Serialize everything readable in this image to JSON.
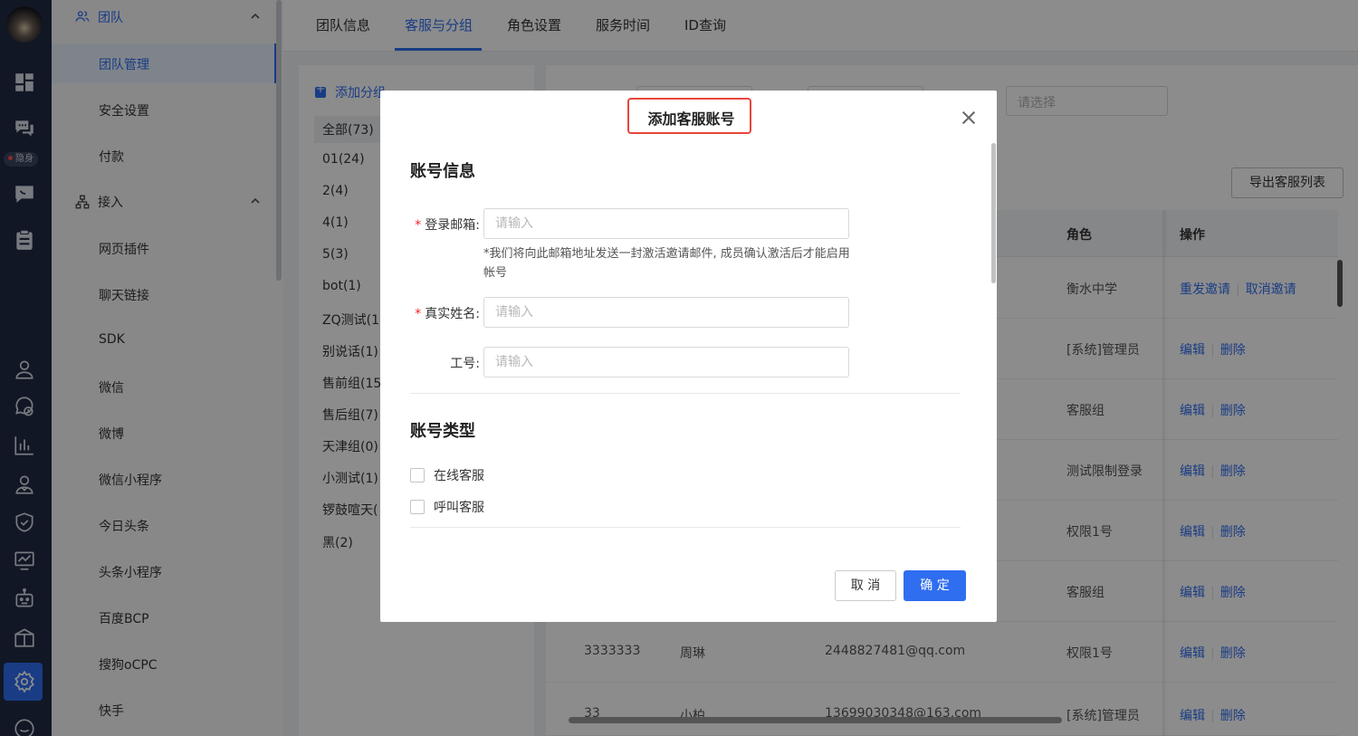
{
  "rail": {
    "badge_label": "隐身"
  },
  "sidebar": {
    "groups": [
      {
        "label": "团队"
      },
      {
        "label": "接入"
      }
    ],
    "team_items": [
      "团队管理",
      "安全设置",
      "付款"
    ],
    "access_items": [
      "网页插件",
      "聊天链接",
      "SDK",
      "微信",
      "微博",
      "微信小程序",
      "今日头条",
      "头条小程序",
      "百度BCP",
      "搜狗oCPC",
      "快手"
    ]
  },
  "tabs": [
    "团队信息",
    "客服与分组",
    "角色设置",
    "服务时间",
    "ID查询"
  ],
  "group_panel": {
    "add_label": "添加分组",
    "groups": [
      "全部(73)",
      "01(24)",
      "2(4)",
      "4(1)",
      "5(3)",
      "bot(1)",
      "ZQ测试(1",
      "别说话(1)",
      "售前组(15",
      "售后组(7)",
      "天津组(0)",
      "小测试(1)",
      "锣鼓喧天(",
      "黑(2)"
    ]
  },
  "table_panel": {
    "select_placeholder": "请选择",
    "export_label": "导出客服列表",
    "headers": {
      "role": "角色",
      "actions": "操作"
    },
    "rows": [
      {
        "id": "",
        "name": "",
        "email": "",
        "role": "衡水中学",
        "action1": "重发邀请",
        "action2": "取消邀请"
      },
      {
        "id": "",
        "name": "",
        "email": "",
        "role": "[系统]管理员",
        "action1": "编辑",
        "action2": "删除"
      },
      {
        "id": "",
        "name": "",
        "email": "",
        "role": "客服组",
        "action1": "编辑",
        "action2": "删除"
      },
      {
        "id": "",
        "name": "",
        "email": "",
        "role": "测试限制登录",
        "action1": "编辑",
        "action2": "删除"
      },
      {
        "id": "",
        "name": "",
        "email": "",
        "role": "权限1号",
        "action1": "编辑",
        "action2": "删除"
      },
      {
        "id": "",
        "name": "",
        "email": "",
        "role": "客服组",
        "action1": "编辑",
        "action2": "删除"
      },
      {
        "id": "3333333",
        "name": "周琳",
        "email": "2448827481@qq.com",
        "role": "权限1号",
        "action1": "编辑",
        "action2": "删除"
      },
      {
        "id": "33",
        "name": "小柏",
        "email": "13699030348@163.com",
        "role": "[系统]管理员",
        "action1": "编辑",
        "action2": "删除"
      }
    ]
  },
  "modal": {
    "title": "添加客服账号",
    "section_account_info": "账号信息",
    "email_label": "登录邮箱:",
    "email_placeholder": "请输入",
    "email_hint": "*我们将向此邮箱地址发送一封激活邀请邮件, 成员确认激活后才能启用帐号",
    "name_label": "真实姓名:",
    "name_placeholder": "请输入",
    "jobno_label": "工号:",
    "jobno_placeholder": "请输入",
    "section_account_type": "账号类型",
    "type_online": "在线客服",
    "type_call": "呼叫客服",
    "cancel_label": "取 消",
    "ok_label": "确 定"
  },
  "colors": {
    "primary": "#2f6ef0",
    "rail": "#1f2a44",
    "highlight": "#e8463a",
    "required": "#f5222d"
  }
}
